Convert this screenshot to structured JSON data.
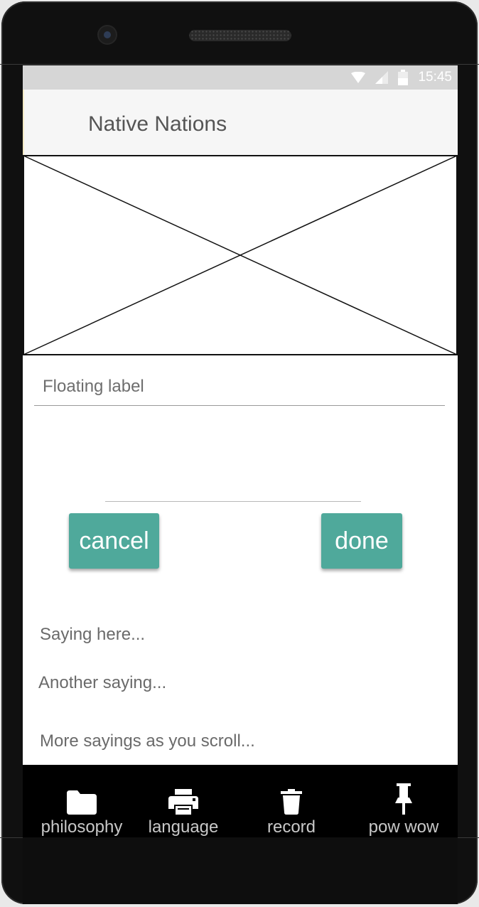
{
  "status_bar": {
    "time": "15:45",
    "icons": [
      "wifi-icon",
      "signal-icon",
      "battery-icon"
    ]
  },
  "app_bar": {
    "title": "Native Nations"
  },
  "image_placeholder": {
    "icon": "image-placeholder"
  },
  "form": {
    "floating_label": "Floating label"
  },
  "buttons": {
    "cancel_label": "cancel",
    "done_label": "done",
    "color": "#4fa99b"
  },
  "sayings": [
    "Saying here...",
    "Another saying...",
    "More sayings as you scroll..."
  ],
  "bottom_nav": {
    "items": [
      {
        "label": "philosophy",
        "icon": "folder-icon"
      },
      {
        "label": "language",
        "icon": "printer-icon"
      },
      {
        "label": "record",
        "icon": "trash-icon"
      },
      {
        "label": "pow wow",
        "icon": "pin-icon"
      }
    ]
  }
}
